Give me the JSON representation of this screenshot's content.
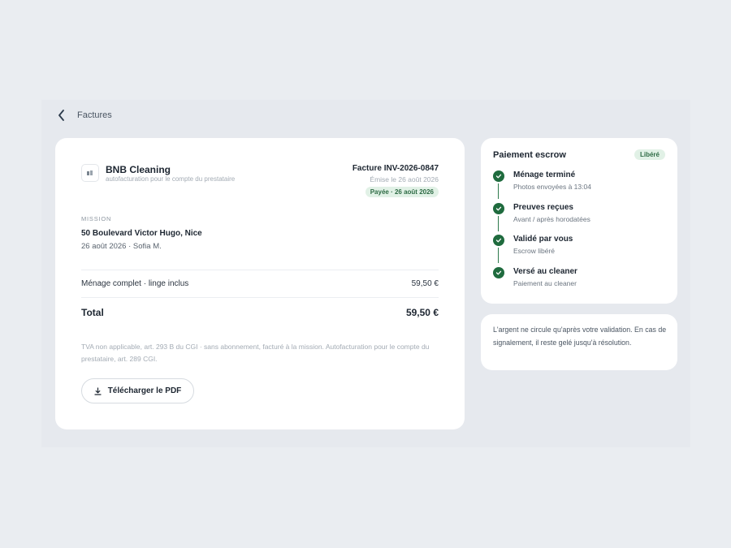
{
  "breadcrumb": {
    "label": "Factures",
    "back_icon": "chevron-left-icon"
  },
  "invoice": {
    "brand": "BNB Cleaning",
    "brand_subtitle": "autofacturation pour le compte du prestataire",
    "logo_icon": "building-icon",
    "number": "Facture INV-2026-0847",
    "issued": "Émise le 26 août 2026",
    "status": "Payée · 26 août 2026",
    "mission_label": "MISSION",
    "address": "50 Boulevard Victor Hugo, Nice",
    "date_line": "26 août 2026 · Sofia M.",
    "line_items": [
      {
        "label": "Ménage complet · linge inclus",
        "amount": "59,50 €"
      }
    ],
    "total_label": "Total",
    "total_amount": "59,50 €",
    "legal": "TVA non applicable, art. 293 B du CGI · sans abonnement, facturé à la mission. Autofacturation pour le compte du prestataire, art. 289 CGI.",
    "download_label": "Télécharger le PDF",
    "download_icon": "download-icon"
  },
  "escrow": {
    "title": "Paiement escrow",
    "badge": "Libéré",
    "steps": [
      {
        "title": "Ménage terminé",
        "subtitle": "Photos envoyées à 13:04"
      },
      {
        "title": "Preuves reçues",
        "subtitle": "Avant / après horodatées"
      },
      {
        "title": "Validé par vous",
        "subtitle": "Escrow libéré"
      },
      {
        "title": "Versé au cleaner",
        "subtitle": "Paiement au cleaner"
      }
    ]
  },
  "note": {
    "text": "L'argent ne circule qu'après votre validation. En cas de signalement, il reste gelé jusqu'à résolution."
  },
  "colors": {
    "accent_green": "#1f6b3e",
    "badge_bg": "#e1f1e6",
    "page_bg": "#eaedf1"
  }
}
